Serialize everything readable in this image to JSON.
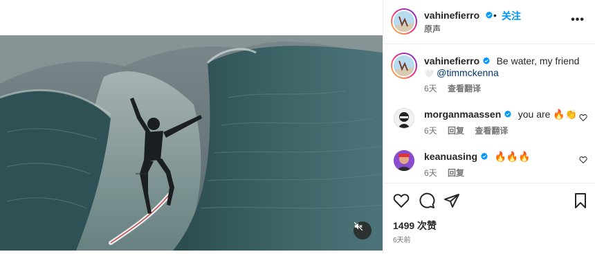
{
  "post": {
    "author": "vahinefierro",
    "audio": "原声",
    "follow_label": "关注",
    "dot": "•",
    "more": "•••"
  },
  "caption": {
    "author": "vahinefierro",
    "text": "Be water, my friend",
    "mention_prefix": "🤍",
    "mention": "@timmckenna",
    "time": "6天",
    "translate": "查看翻译"
  },
  "comments": [
    {
      "author": "morganmaassen",
      "text": "you are 🔥👏",
      "time": "6天",
      "reply": "回复",
      "translate": "查看翻译"
    },
    {
      "author": "keanuasing",
      "text": "🔥🔥🔥",
      "time": "6天",
      "reply": "回复"
    }
  ],
  "footer": {
    "likes": "1499 次赞",
    "posted": "6天前"
  },
  "icons": {
    "like": "heart-icon",
    "comment": "comment-icon",
    "share": "send-icon",
    "save": "bookmark-icon",
    "mute": "muted-speaker-icon",
    "verified": "verified-badge-icon"
  },
  "colors": {
    "link": "#0095f6",
    "verified": "#0095f6",
    "text": "#262626",
    "secondary": "#737373"
  }
}
